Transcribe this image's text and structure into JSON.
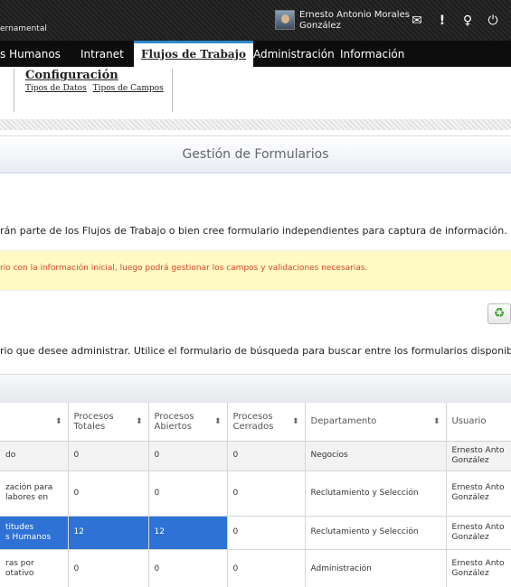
{
  "header": {
    "brand": "ernamental",
    "user_name_line1": "Ernesto Antonio Morales",
    "user_name_line2": "González",
    "icons": [
      "mail-icon",
      "alert-icon",
      "lightbulb-icon",
      "power-icon"
    ],
    "icon_glyphs": [
      "✉",
      "!",
      "♀",
      "⏻"
    ]
  },
  "nav": {
    "items": [
      "s Humanos",
      "Intranet",
      "Flujos de Trabajo",
      "Administración",
      "Información"
    ],
    "active": "Flujos de Trabajo"
  },
  "submenu": {
    "title": "Configuración",
    "links": [
      "Tipos de Datos",
      "Tipos de Campos"
    ]
  },
  "panel": {
    "title": "Gestión de Formularios"
  },
  "texts": {
    "desc1": "rán parte de los Flujos de Trabajo o bien cree formulario independientes para captura de información.",
    "notice": "rio con la información inicial, luego podrá gestionar los campos y validaciones necesarias.",
    "desc2": "rio que desee administrar. Utilice el formulario de búsqueda para buscar entre los formularios disponibles."
  },
  "refresh": {
    "glyph": "♻"
  },
  "table": {
    "columns": [
      {
        "label1": "",
        "label2": ""
      },
      {
        "label1": "Procesos",
        "label2": "Totales"
      },
      {
        "label1": "Procesos",
        "label2": "Abiertos"
      },
      {
        "label1": "Procesos",
        "label2": "Cerrados"
      },
      {
        "label1": "Departamento",
        "label2": ""
      },
      {
        "label1": "Usuario",
        "label2": ""
      }
    ],
    "sort_glyph": "⬍",
    "rows": [
      {
        "name1": "do",
        "name2": "",
        "totales": "0",
        "abiertos": "0",
        "cerrados": "0",
        "departamento": "Negocios",
        "usuario1": "Ernesto Anto",
        "usuario2": "González"
      },
      {
        "name1": "zación para",
        "name2": "labores en",
        "totales": "0",
        "abiertos": "0",
        "cerrados": "0",
        "departamento": "Reclutamiento y Selección",
        "usuario1": "Ernesto Anto",
        "usuario2": "González"
      },
      {
        "name1": "titudes",
        "name2": "s Humanos",
        "totales": "12",
        "abiertos": "12",
        "cerrados": "0",
        "departamento": "Reclutamiento y Selección",
        "usuario1": "Ernesto Anto",
        "usuario2": "González"
      },
      {
        "name1": "ras por",
        "name2": "otativo",
        "totales": "0",
        "abiertos": "0",
        "cerrados": "0",
        "departamento": "Administración",
        "usuario1": "Ernesto Anto",
        "usuario2": "González"
      }
    ]
  }
}
